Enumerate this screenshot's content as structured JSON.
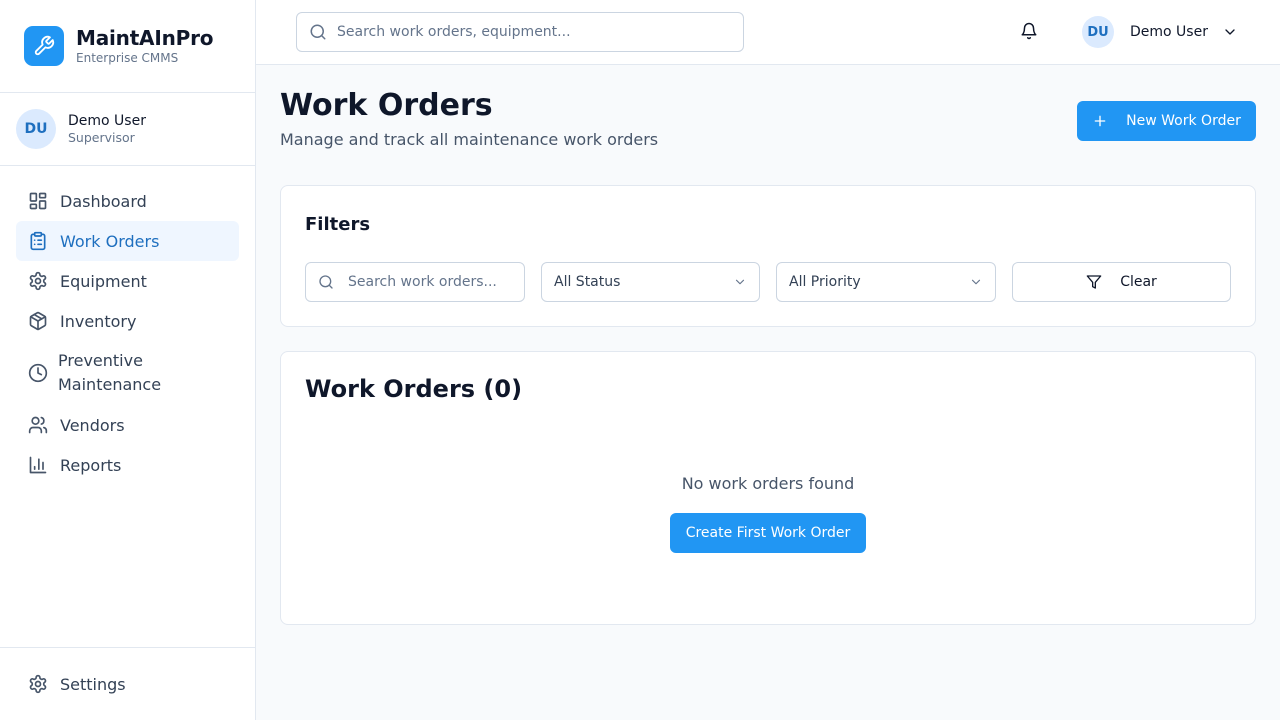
{
  "brand": {
    "name": "MaintAInPro",
    "subtitle": "Enterprise CMMS",
    "icon": "wrench-icon"
  },
  "sidebar_user": {
    "initials": "DU",
    "name": "Demo User",
    "role": "Supervisor"
  },
  "nav": {
    "items": [
      {
        "label": "Dashboard",
        "icon": "dashboard-icon"
      },
      {
        "label": "Work Orders",
        "icon": "clipboard-icon",
        "active": true
      },
      {
        "label": "Equipment",
        "icon": "gear-icon"
      },
      {
        "label": "Inventory",
        "icon": "package-icon"
      },
      {
        "label_line1": "Preventive",
        "label_line2": "Maintenance",
        "icon": "clock-icon"
      },
      {
        "label": "Vendors",
        "icon": "users-icon"
      },
      {
        "label": "Reports",
        "icon": "bar-chart-icon"
      }
    ],
    "settings": {
      "label": "Settings",
      "icon": "gear-icon"
    }
  },
  "topbar": {
    "search_placeholder": "Search work orders, equipment...",
    "user_initials": "DU",
    "user_name": "Demo User"
  },
  "page": {
    "title": "Work Orders",
    "subtitle": "Manage and track all maintenance work orders",
    "new_button": "New Work Order"
  },
  "filters": {
    "title": "Filters",
    "search_placeholder": "Search work orders...",
    "status_selected": "All Status",
    "priority_selected": "All Priority",
    "clear_label": "Clear"
  },
  "list": {
    "title": "Work Orders (0)",
    "empty_message": "No work orders found",
    "create_button": "Create First Work Order"
  },
  "colors": {
    "accent": "#2196f3",
    "active_bg": "#eff6ff",
    "active_text": "#1e6fbf",
    "avatar_bg": "#dbeafe"
  }
}
